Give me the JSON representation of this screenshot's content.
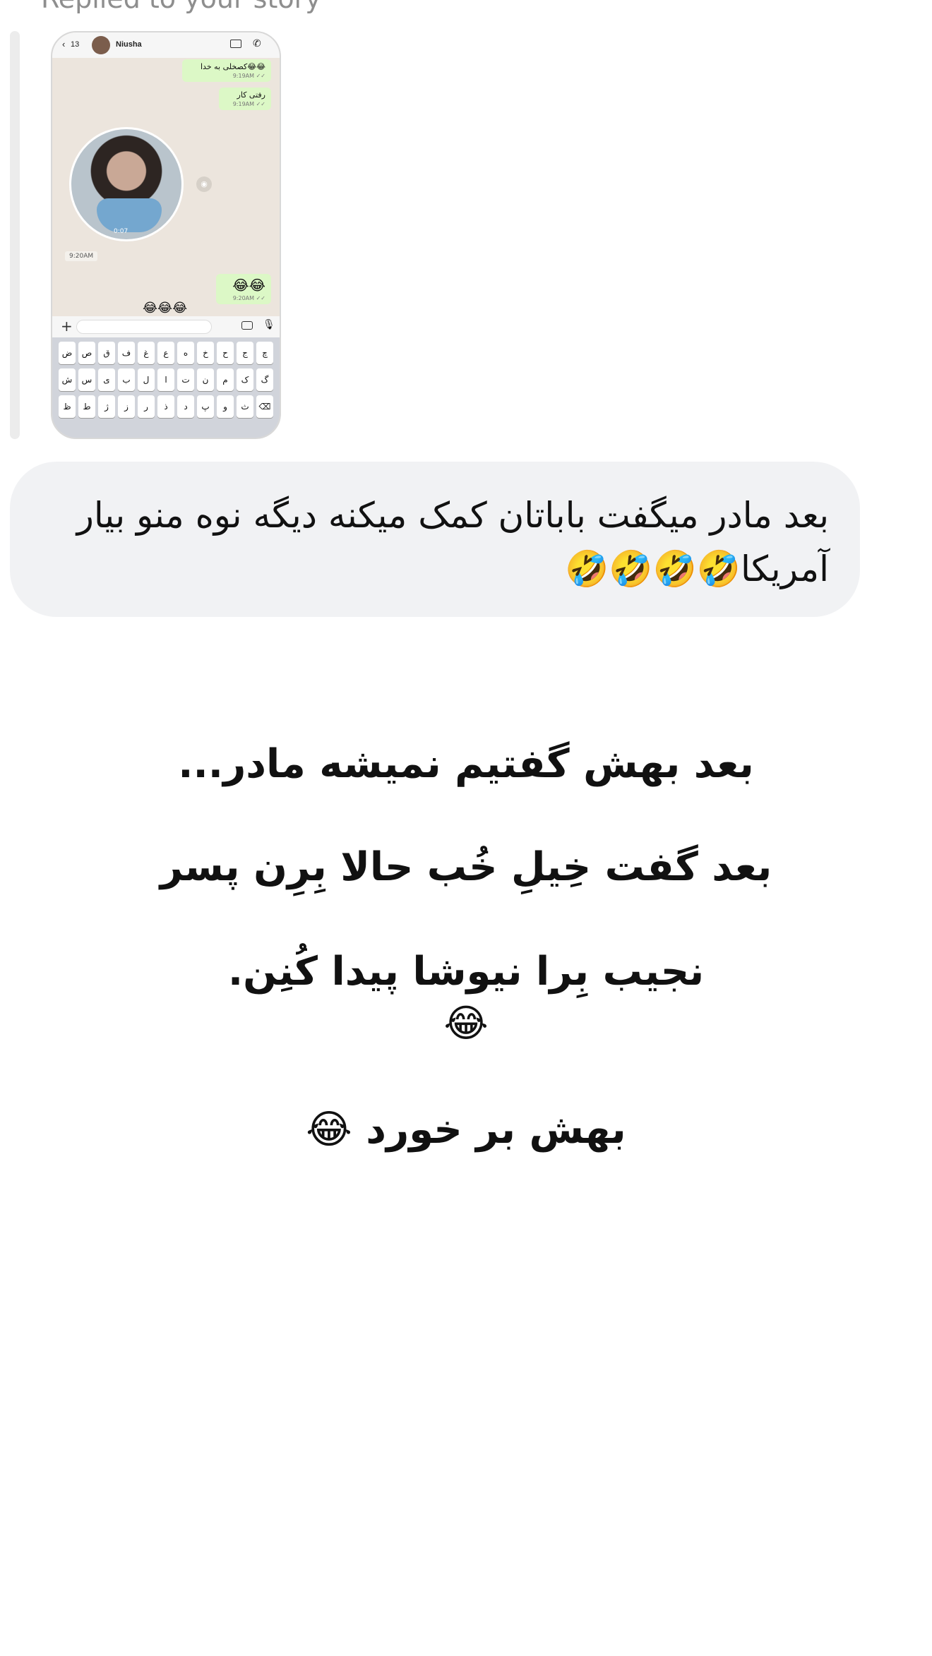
{
  "reply_header": "Replied to your story",
  "story": {
    "whatsapp": {
      "count": "13",
      "contact_name": "Niusha",
      "bubbles": [
        {
          "text": "کصخلی به خدا😂😂",
          "time": "9:19AM ✓✓"
        },
        {
          "text": "رفتی کار",
          "time": "9:19AM ✓✓"
        },
        {
          "text": "😂😂",
          "time": "9:20AM ✓✓"
        }
      ],
      "video_duration": "0:07",
      "date_stamp": "9:20AM",
      "laugh": "😂😂😂",
      "keyboard_rows": [
        [
          "ض",
          "ص",
          "ق",
          "ف",
          "غ",
          "ع",
          "ه",
          "خ",
          "ح",
          "ج",
          "چ"
        ],
        [
          "ش",
          "س",
          "ی",
          "ب",
          "ل",
          "ا",
          "ت",
          "ن",
          "م",
          "ک",
          "گ"
        ],
        [
          "ظ",
          "ط",
          "ژ",
          "ز",
          "ر",
          "ذ",
          "د",
          "پ",
          "و",
          "ث",
          "⌫"
        ]
      ]
    }
  },
  "message": {
    "text": "بعد مادر میگفت باباتان کمک میکنه دیگه نوه منو بیار آمریکا🤣🤣🤣🤣"
  },
  "caption": {
    "line1": "بعد بهش گفتیم نمیشه مادر...",
    "line2": "بعد گفت خِیلِ خُب حالا بِرِن پسر",
    "line3": "نجیب بِرا نیوشا پیدا کُنِن.",
    "line4": "😂",
    "line5": "بهش بر خورد 😂"
  }
}
